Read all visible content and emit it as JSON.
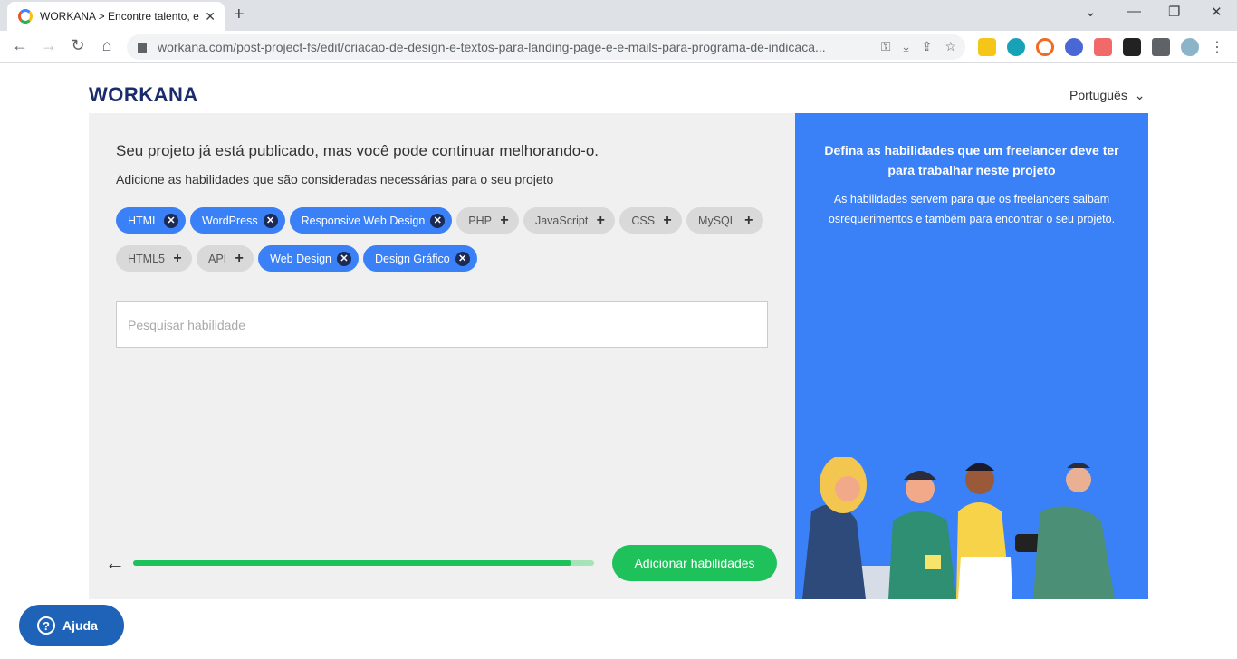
{
  "browser": {
    "tab_title": "WORKANA > Encontre talento, e",
    "tab_close": "✕",
    "new_tab": "+",
    "url": "workana.com/post-project-fs/edit/criacao-de-design-e-textos-para-landing-page-e-e-mails-para-programa-de-indicaca...",
    "back": "←",
    "forward": "→",
    "reload": "↻",
    "home": "⌂",
    "minimize": "⌄",
    "restore": "—",
    "maximize": "❐",
    "close": "✕",
    "menu": "⋮"
  },
  "header": {
    "logo": "WORKANA",
    "language": "Português",
    "language_chevron": "⌄"
  },
  "main": {
    "headline": "Seu projeto já está publicado, mas você pode continuar melhorando-o.",
    "subline": "Adicione as habilidades que são consideradas necessárias para o seu projeto",
    "skills": [
      {
        "label": "HTML",
        "selected": true,
        "icon": "✕"
      },
      {
        "label": "WordPress",
        "selected": true,
        "icon": "✕"
      },
      {
        "label": "Responsive Web Design",
        "selected": true,
        "icon": "✕"
      },
      {
        "label": "PHP",
        "selected": false,
        "icon": "+"
      },
      {
        "label": "JavaScript",
        "selected": false,
        "icon": "+"
      },
      {
        "label": "CSS",
        "selected": false,
        "icon": "+"
      },
      {
        "label": "MySQL",
        "selected": false,
        "icon": "+"
      },
      {
        "label": "HTML5",
        "selected": false,
        "icon": "+"
      },
      {
        "label": "API",
        "selected": false,
        "icon": "+"
      },
      {
        "label": "Web Design",
        "selected": true,
        "icon": "✕"
      },
      {
        "label": "Design Gráfico",
        "selected": true,
        "icon": "✕"
      }
    ],
    "search_placeholder": "Pesquisar habilidade",
    "back_arrow": "←",
    "progress_fraction": 0.95,
    "submit_label": "Adicionar habilidades"
  },
  "sidebar": {
    "title": "Defina as habilidades que um freelancer deve ter para trabalhar neste projeto",
    "text": "As habilidades servem para que os freelancers saibam osrequerimentos e também para encontrar o seu projeto."
  },
  "help": {
    "icon": "?",
    "label": "Ajuda"
  },
  "colors": {
    "brand_blue": "#3a80f7",
    "green": "#1fc15b"
  }
}
